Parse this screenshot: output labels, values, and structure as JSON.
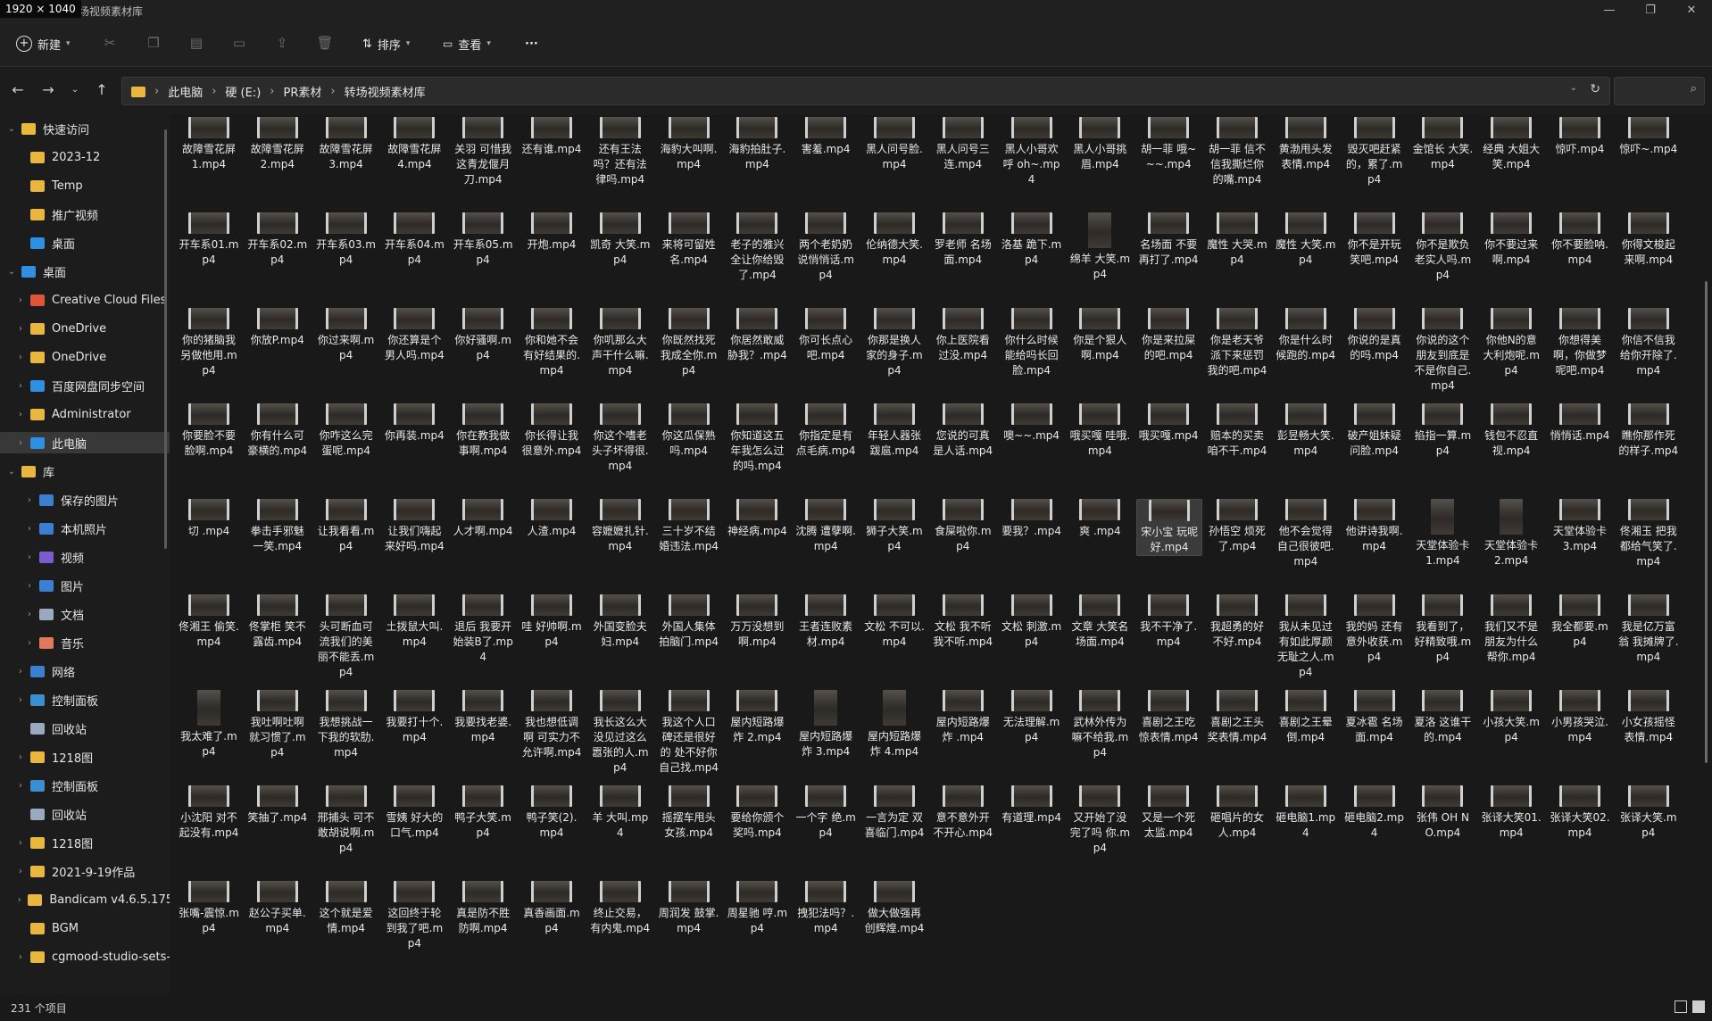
{
  "badge": "1920 × 1040",
  "window": {
    "title": "\\转场视频素材库"
  },
  "toolbar": {
    "new_label": "新建",
    "sort_label": "排序",
    "view_label": "查看",
    "more_label": "···"
  },
  "address": {
    "crumbs": [
      "此电脑",
      "硬 (E:)",
      "PR素材",
      "转场视频素材库"
    ]
  },
  "sidebar": {
    "items": [
      {
        "label": "快速访问",
        "indent": 0,
        "chev": "⌄",
        "color": "#e8b93d"
      },
      {
        "label": "2023-12",
        "indent": 1,
        "chev": "",
        "color": "#e9b740"
      },
      {
        "label": "Temp",
        "indent": 1,
        "chev": "",
        "color": "#e9b740"
      },
      {
        "label": "推广视频",
        "indent": 1,
        "chev": "",
        "color": "#e9b740"
      },
      {
        "label": "桌面",
        "indent": 1,
        "chev": "",
        "color": "#2f8fe0"
      },
      {
        "label": "桌面",
        "indent": 0,
        "chev": "⌄",
        "color": "#2f8fe0"
      },
      {
        "label": "Creative Cloud Files",
        "indent": 1,
        "chev": "›",
        "color": "#e0553a"
      },
      {
        "label": "OneDrive",
        "indent": 1,
        "chev": "›",
        "color": "#e9b740"
      },
      {
        "label": "OneDrive",
        "indent": 1,
        "chev": "›",
        "color": "#e9b740"
      },
      {
        "label": "百度网盘同步空间",
        "indent": 1,
        "chev": "›",
        "color": "#2f8fe0"
      },
      {
        "label": "Administrator",
        "indent": 1,
        "chev": "›",
        "color": "#e9b740"
      },
      {
        "label": "此电脑",
        "indent": 1,
        "chev": "›",
        "color": "#2f8fe0",
        "selected": true
      },
      {
        "label": "库",
        "indent": 0,
        "chev": "⌄",
        "color": "#e9b740"
      },
      {
        "label": "保存的图片",
        "indent": 2,
        "chev": "›",
        "color": "#3a7fd0"
      },
      {
        "label": "本机照片",
        "indent": 2,
        "chev": "›",
        "color": "#3a7fd0"
      },
      {
        "label": "视频",
        "indent": 2,
        "chev": "›",
        "color": "#7a5cd0"
      },
      {
        "label": "图片",
        "indent": 2,
        "chev": "›",
        "color": "#3a7fd0"
      },
      {
        "label": "文档",
        "indent": 2,
        "chev": "›",
        "color": "#9aa9c0"
      },
      {
        "label": "音乐",
        "indent": 2,
        "chev": "›",
        "color": "#e07a5a"
      },
      {
        "label": "网络",
        "indent": 1,
        "chev": "›",
        "color": "#3a7fd0"
      },
      {
        "label": "控制面板",
        "indent": 1,
        "chev": "›",
        "color": "#3a8fd0"
      },
      {
        "label": "回收站",
        "indent": 1,
        "chev": "",
        "color": "#9aa9c0"
      },
      {
        "label": "1218图",
        "indent": 1,
        "chev": "›",
        "color": "#e9b740"
      },
      {
        "label": "控制面板",
        "indent": 1,
        "chev": "›",
        "color": "#3a8fd0"
      },
      {
        "label": "回收站",
        "indent": 1,
        "chev": "",
        "color": "#9aa9c0"
      },
      {
        "label": "1218图",
        "indent": 1,
        "chev": "›",
        "color": "#e9b740"
      },
      {
        "label": "2021-9-19作品",
        "indent": 1,
        "chev": "›",
        "color": "#e9b740"
      },
      {
        "label": "Bandicam v4.6.5.175",
        "indent": 1,
        "chev": "›",
        "color": "#e9b740"
      },
      {
        "label": "BGM",
        "indent": 1,
        "chev": "",
        "color": "#e9b740"
      },
      {
        "label": "cgmood-studio-sets-",
        "indent": 1,
        "chev": "›",
        "color": "#e9b740"
      }
    ]
  },
  "files": [
    [
      "故障雪花屏1.mp4",
      "故障雪花屏2.mp4",
      "故障雪花屏3.mp4",
      "故障雪花屏4.mp4",
      "关羽 可惜我这青龙偃月刀.mp4",
      "还有谁.mp4",
      "还有王法吗？还有法律吗.mp4",
      "海豹大叫啊.mp4",
      "海豹拍肚子.mp4",
      "害羞.mp4",
      "黑人问号脸.mp4",
      "黑人问号三连.mp4",
      "黑人小哥欢呼 oh~.mp4",
      "黑人小哥挑眉.mp4",
      "胡一菲 哦~~~.mp4",
      "胡一菲 信不信我撕烂你的嘴.mp4",
      "黄渤甩头发表情.mp4",
      "毁灭吧赶紧的，累了.mp4",
      "金馆长 大笑.mp4",
      "经典 大姐大笑.mp4",
      "惊吓.mp4",
      "惊吓~.mp4"
    ],
    [
      "开车系01.mp4",
      "开车系02.mp4",
      "开车系03.mp4",
      "开车系04.mp4",
      "开车系05.mp4",
      "开炮.mp4",
      "凯奇 大笑.mp4",
      "来将可留姓名.mp4",
      "老子的雅兴全让你给毁了.mp4",
      "两个老奶奶说悄悄话.mp4",
      "伦纳德大笑.mp4",
      "罗老师 名场面.mp4",
      "洛基 跪下.mp4",
      "绵羊 大笑.mp4",
      "名场面 不要再打了.mp4",
      "魔性 大哭.mp4",
      "魔性 大笑.mp4",
      "你不是开玩笑吧.mp4",
      "你不是欺负老实人吗.mp4",
      "你不要过来啊.mp4",
      "你不要脸呐.mp4",
      "你得文梭起来啊.mp4"
    ],
    [
      "你的猪脑我另做他用.mp4",
      "你放P.mp4",
      "你过来啊.mp4",
      "你还算是个男人吗.mp4",
      "你好骚啊.mp4",
      "你和她不会有好结果的.mp4",
      "你叽那么大声干什么嘛.mp4",
      "你既然找死我成全你.mp4",
      "你居然敢威胁我？.mp4",
      "你可长点心吧.mp4",
      "你那是换人家的身子.mp4",
      "你上医院看过没.mp4",
      "你什么时候能给吗长回脸.mp4",
      "你是个狠人啊.mp4",
      "你是来拉屎的吧.mp4",
      "你是老天爷派下来惩罚我的吧.mp4",
      "你是什么时候跑的.mp4",
      "你说的是真的吗.mp4",
      "你说的这个朋友到底是不是你自己.mp4",
      "你他N的意大利炮呢.mp4",
      "你想得美啊，你做梦呢吧.mp4",
      "你信不信我给你开除了.mp4"
    ],
    [
      "你要脸不要脸啊.mp4",
      "你有什么可豪横的.mp4",
      "你咋这么完蛋呢.mp4",
      "你再装.mp4",
      "你在教我做事啊.mp4",
      "你长得让我很意外.mp4",
      "你这个嗜老头子坏得很.mp4",
      "你这瓜保熟吗.mp4",
      "你知道这五年我怎么过的吗.mp4",
      "你指定是有点毛病.mp4",
      "年轻人器张跋扈.mp4",
      "您说的可真是人话.mp4",
      "噢~~.mp4",
      "哦买嘎 哇哦.mp4",
      "哦买嘎.mp4",
      "赔本的买卖咱不干.mp4",
      "彭昱畅大笑.mp4",
      "破产姐妹疑问脸.mp4",
      "掐指一算.mp4",
      "钱包不忍直视.mp4",
      "悄悄话.mp4",
      "瞧你那作死的样子.mp4"
    ],
    [
      "切 .mp4",
      "拳击手邪魅一笑.mp4",
      "让我看看.mp4",
      "让我们嗨起来好吗.mp4",
      "人才啊.mp4",
      "人渣.mp4",
      "容嬷嬷扎针.mp4",
      "三十岁不结婚违法.mp4",
      "神经病.mp4",
      "沈腾 遭孽啊.mp4",
      "狮子大笑.mp4",
      "食屎啦你.mp4",
      "要我？.mp4",
      "爽 .mp4",
      "宋小宝 玩呢好.mp4",
      "孙悟空 烦死了.mp4",
      "他不会觉得自己很彼吧.mp4",
      "他讲诗我啊.mp4",
      "天堂体验卡1.mp4",
      "天堂体验卡2.mp4",
      "天堂体验卡3.mp4",
      "佟湘玉 把我都给气笑了.mp4"
    ],
    [
      "佟湘王 偷笑.mp4",
      "佟掌柜 笑不露齿.mp4",
      "头可断血可流我们的美丽不能丢.mp4",
      "土拨鼠大叫.mp4",
      "退后 我要开始装B了.mp4",
      "哇 好帅啊.mp4",
      "外国变脸夫妇.mp4",
      "外国人集体拍脑门.mp4",
      "万万没想到啊.mp4",
      "王者连败素材.mp4",
      "文松 不可以.mp4",
      "文松 我不听 我不听.mp4",
      "文松 刺激.mp4",
      "文章 大笑名场面.mp4",
      "我不干净了.mp4",
      "我超勇的好不好.mp4",
      "我从未见过有如此厚颜无耻之人.mp4",
      "我的妈 还有意外收获.mp4",
      "我看到了，好精致哦.mp4",
      "我们又不是朋友为什么帮你.mp4",
      "我全都要.mp4",
      "我是亿万富翁 我摊牌了.mp4"
    ],
    [
      "我太难了.mp4",
      "我吐啊吐啊就习惯了.mp4",
      "我想挑战一下我的软肋.mp4",
      "我要打十个.mp4",
      "我要找老婆.mp4",
      "我也想低调啊 可实力不允许啊.mp4",
      "我长这么大没见过这么嚣张的人.mp4",
      "我这个人口碑还是很好的 处不好你自己找.mp4",
      "屋内短路爆炸 2.mp4",
      "屋内短路爆炸 3.mp4",
      "屋内短路爆炸 4.mp4",
      "屋内短路爆炸 .mp4",
      "无法理解.mp4",
      "武林外传为嘛不给我.mp4",
      "喜剧之王吃惊表情.mp4",
      "喜剧之王头奖表情.mp4",
      "喜剧之王晕倒.mp4",
      "夏冰雹 名场面.mp4",
      "夏洛 这谁干的.mp4",
      "小孩大笑.mp4",
      "小男孩哭泣.mp4",
      "小女孩摇怪表情.mp4"
    ],
    [
      "小沈阳 对不起没有.mp4",
      "笑抽了.mp4",
      "邢捕头 可不敢胡说啊.mp4",
      "雪姨 好大的口气.mp4",
      "鸭子大笑.mp4",
      "鸭子笑(2).mp4",
      "羊 大叫.mp4",
      "摇摆车甩头女孩.mp4",
      "要给你颁个奖吗.mp4",
      "一个字 绝.mp4",
      "一言为定 双喜临门.mp4",
      "意不意外开不开心.mp4",
      "有道理.mp4",
      "又开始了没完了吗 你.mp4",
      "又是一个死太监.mp4",
      "砸唱片的女人.mp4",
      "砸电脑1.mp4",
      "砸电脑2.mp4",
      "张伟 OH NO.mp4",
      "张译大笑01.mp4",
      "张译大笑02.mp4",
      "张译大笑.mp4"
    ],
    [
      "张嘴-震惊.mp4",
      "赵公子买单.mp4",
      "这个就是爱情.mp4",
      "这回终于轮到我了吧.mp4",
      "真是防不胜防啊.mp4",
      "真香画面.mp4",
      "终止交易，有内鬼.mp4",
      "周润发 鼓掌.mp4",
      "周星驰 哼.mp4",
      "拽犯法吗？.mp4",
      "做大做强再创辉煌.mp4"
    ]
  ],
  "status": {
    "count": "231 个项目"
  }
}
